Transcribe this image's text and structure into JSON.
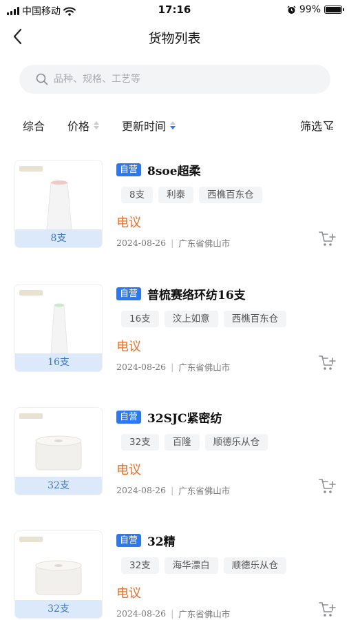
{
  "status_bar": {
    "carrier": "中国移动",
    "time": "17:16",
    "battery_percent": "99%",
    "battery_level": 0.99
  },
  "header": {
    "title": "货物列表"
  },
  "search": {
    "placeholder": "品种、规格、工艺等"
  },
  "sort_bar": {
    "items": [
      {
        "label": "综合"
      },
      {
        "label": "价格",
        "state": "none"
      },
      {
        "label": "更新时间",
        "state": "desc"
      }
    ],
    "filter_label": "筛选"
  },
  "products": [
    {
      "badge": "自营",
      "title": "8soe超柔",
      "spec": "8支",
      "tags": [
        "8支",
        "利泰",
        "西樵百东仓"
      ],
      "price": "电议",
      "date": "2024-08-26",
      "location": "广东省佛山市"
    },
    {
      "badge": "自营",
      "title": "普梳赛络环纺16支",
      "spec": "16支",
      "tags": [
        "16支",
        "汶上如意",
        "西樵百东仓"
      ],
      "price": "电议",
      "date": "2024-08-26",
      "location": "广东省佛山市"
    },
    {
      "badge": "自营",
      "title": "32SJC紧密纺",
      "spec": "32支",
      "tags": [
        "32支",
        "百隆",
        "顺德乐从仓"
      ],
      "price": "电议",
      "date": "2024-08-26",
      "location": "广东省佛山市"
    },
    {
      "badge": "自营",
      "title": "32精",
      "spec": "32支",
      "tags": [
        "32支",
        "海华漂白",
        "顺德乐从仓"
      ],
      "price": "电议",
      "date": "2024-08-26",
      "location": "广东省佛山市"
    }
  ],
  "colors": {
    "accent": "#2b78f0",
    "price": "#f26b21",
    "spec_strip": "#dbe9fb"
  }
}
